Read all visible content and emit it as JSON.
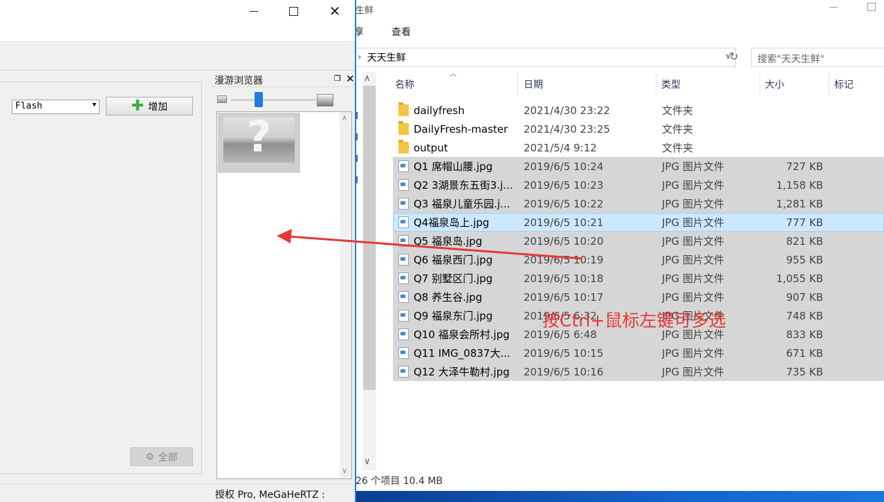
{
  "explorer": {
    "title": "生鲜",
    "menu": {
      "share": "享",
      "view": "查看"
    },
    "address": "天天生鲜",
    "search_placeholder": "搜索\"天天生鲜\"",
    "columns": {
      "name": "名称",
      "date": "日期",
      "type": "类型",
      "size": "大小",
      "tags": "标记"
    },
    "rows": [
      {
        "name": "dailyfresh",
        "date": "2021/4/30 23:22",
        "type": "文件夹",
        "size": "",
        "icon": "folder-icon",
        "state": "normal"
      },
      {
        "name": "DailyFresh-master",
        "date": "2021/4/30 23:25",
        "type": "文件夹",
        "size": "",
        "icon": "folder-icon",
        "state": "normal"
      },
      {
        "name": "output",
        "date": "2021/5/4 9:12",
        "type": "文件夹",
        "size": "",
        "icon": "folder-icon",
        "state": "normal"
      },
      {
        "name": "Q1 席帽山腰.jpg",
        "date": "2019/6/5 10:24",
        "type": "JPG 图片文件",
        "size": "727 KB",
        "icon": "jpg-file-icon",
        "state": "selected"
      },
      {
        "name": "Q2  3湖景东五街3.j...",
        "date": "2019/6/5 10:23",
        "type": "JPG 图片文件",
        "size": "1,158 KB",
        "icon": "jpg-file-icon",
        "state": "selected"
      },
      {
        "name": "Q3 福泉儿童乐园.j...",
        "date": "2019/6/5 10:22",
        "type": "JPG 图片文件",
        "size": "1,281 KB",
        "icon": "jpg-file-icon",
        "state": "selected"
      },
      {
        "name": "Q4福泉岛上.jpg",
        "date": "2019/6/5 10:21",
        "type": "JPG 图片文件",
        "size": "777 KB",
        "icon": "jpg-file-icon",
        "state": "focused"
      },
      {
        "name": "Q5 福泉岛.jpg",
        "date": "2019/6/5 10:20",
        "type": "JPG 图片文件",
        "size": "821 KB",
        "icon": "jpg-file-icon",
        "state": "selected"
      },
      {
        "name": "Q6 福泉西门.jpg",
        "date": "2019/6/5 10:19",
        "type": "JPG 图片文件",
        "size": "955 KB",
        "icon": "jpg-file-icon",
        "state": "selected"
      },
      {
        "name": "Q7 别墅区门.jpg",
        "date": "2019/6/5 10:18",
        "type": "JPG 图片文件",
        "size": "1,055 KB",
        "icon": "jpg-file-icon",
        "state": "selected"
      },
      {
        "name": "Q8 养生谷.jpg",
        "date": "2019/6/5 10:17",
        "type": "JPG 图片文件",
        "size": "907 KB",
        "icon": "jpg-file-icon",
        "state": "selected"
      },
      {
        "name": "Q9 福泉东门.jpg",
        "date": "2019/6/5 6:32",
        "type": "JPG 图片文件",
        "size": "748 KB",
        "icon": "jpg-file-icon",
        "state": "selected"
      },
      {
        "name": "Q10 福泉会所村.jpg",
        "date": "2019/6/5 6:48",
        "type": "JPG 图片文件",
        "size": "833 KB",
        "icon": "jpg-file-icon",
        "state": "selected"
      },
      {
        "name": "Q11 IMG_0837大...",
        "date": "2019/6/5 10:15",
        "type": "JPG 图片文件",
        "size": "671 KB",
        "icon": "jpg-file-icon",
        "state": "selected"
      },
      {
        "name": "Q12 大泽牛勒村.jpg",
        "date": "2019/6/5 10:16",
        "type": "JPG 图片文件",
        "size": "735 KB",
        "icon": "jpg-file-icon",
        "state": "selected"
      }
    ],
    "status": "26 个项目  10.4 MB",
    "annotation": "按Ctrl+鼠标左键可多选",
    "annotation_color": "#e53935"
  },
  "app": {
    "format_value": "Flash",
    "add_label": "增加",
    "all_label": "全部",
    "browser_title": "漫游浏览器",
    "thumbnail_glyph": "?",
    "license": "授权 Pro, MeGaHeRTZ :",
    "accent": "#1e7de0"
  }
}
